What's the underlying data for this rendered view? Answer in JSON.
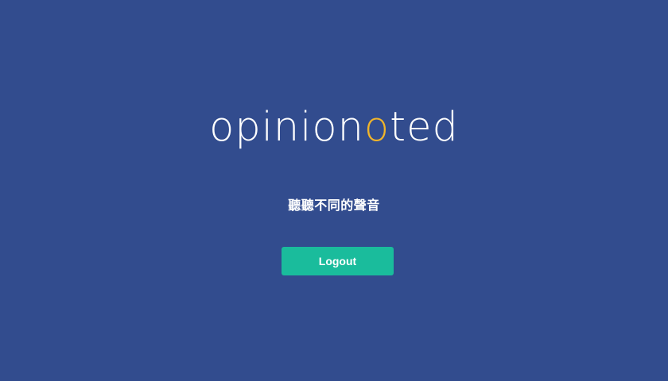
{
  "brand": {
    "logo_prefix": "opinion",
    "logo_accent": "o",
    "logo_suffix": "ted",
    "text_color": "#ffffff",
    "accent_color": "#f1b52a"
  },
  "tagline": "聽聽不同的聲音",
  "actions": {
    "logout_label": "Logout",
    "logout_color": "#1abc9c"
  },
  "theme": {
    "background": "#324c8e"
  }
}
